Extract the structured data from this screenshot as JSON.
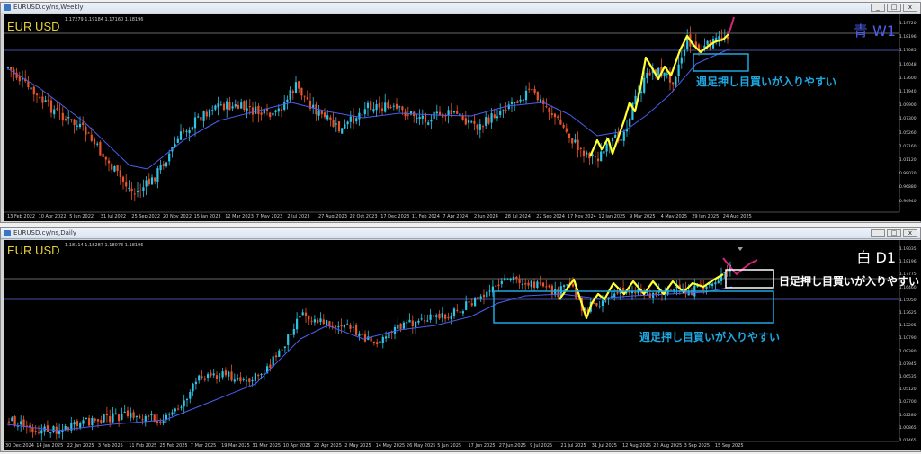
{
  "top": {
    "window_title": "EURUSD.cy/ns,Weekly",
    "symbol": "EUR USD",
    "ohlc": "1.17279 1.19184 1.17160 1.18196",
    "timeframe_label": "青 W1",
    "annotation": "週足押し目買いが入りやすい",
    "price_axis": [
      "1.19720",
      "1.18196",
      "1.17085",
      "1.16048",
      "1.13600",
      "1.11940",
      "1.09900",
      "1.07300",
      "1.05260",
      "1.03160",
      "1.01120",
      "0.99020",
      "0.96880",
      "0.94940"
    ],
    "date_axis": [
      "13 Feb 2022",
      "10 Apr 2022",
      "5 Jun 2022",
      "31 Jul 2022",
      "25 Sep 2022",
      "20 Nov 2022",
      "15 Jan 2023",
      "12 Mar 2023",
      "7 May 2023",
      "2 Jul 2023",
      "27 Aug 2023",
      "22 Oct 2023",
      "17 Dec 2023",
      "11 Feb 2024",
      "7 Apr 2024",
      "2 Jun 2024",
      "28 Jul 2024",
      "22 Sep 2024",
      "17 Nov 2024",
      "12 Jan 2025",
      "9 Mar 2025",
      "4 May 2025",
      "29 Jun 2025",
      "24 Aug 2025"
    ]
  },
  "bottom": {
    "window_title": "EURUSD.cy/ns,Daily",
    "symbol": "EUR USD",
    "ohlc": "1.18114 1.18287 1.18073 1.18196",
    "timeframe_label": "白 D1",
    "annotation_daily": "日足押し目買いが入りやすい",
    "annotation_weekly": "週足押し目買いが入りやすい",
    "price_axis": [
      "1.19035",
      "1.18196",
      "1.17775",
      "1.16460",
      "1.15050",
      "1.13625",
      "1.12205",
      "1.10790",
      "1.09380",
      "1.07945",
      "1.06535",
      "1.05120",
      "1.03700",
      "1.02280",
      "1.00865",
      "1.01465"
    ],
    "date_axis": [
      "30 Dec 2024",
      "14 Jan 2025",
      "22 Jan 2025",
      "3 Feb 2025",
      "11 Feb 2025",
      "25 Feb 2025",
      "7 Mar 2025",
      "19 Mar 2025",
      "31 Mar 2025",
      "10 Apr 2025",
      "22 Apr 2025",
      "2 May 2025",
      "14 May 2025",
      "26 May 2025",
      "5 Jun 2025",
      "17 Jun 2025",
      "27 Jun 2025",
      "9 Jul 2025",
      "21 Jul 2025",
      "31 Jul 2025",
      "12 Aug 2025",
      "22 Aug 2025",
      "3 Sep 2025",
      "15 Sep 2025"
    ]
  },
  "window_buttons": [
    "_",
    "□",
    "x"
  ],
  "colors": {
    "bull": "#2ec4e6",
    "bear": "#e8542a",
    "ma": "#4a5ef0",
    "zigzag": "#ffff33",
    "projection": "#d8237a",
    "weekly_box": "#1ea7e0",
    "daily_box": "#ffffff",
    "hline": "#5b6bd6"
  }
}
